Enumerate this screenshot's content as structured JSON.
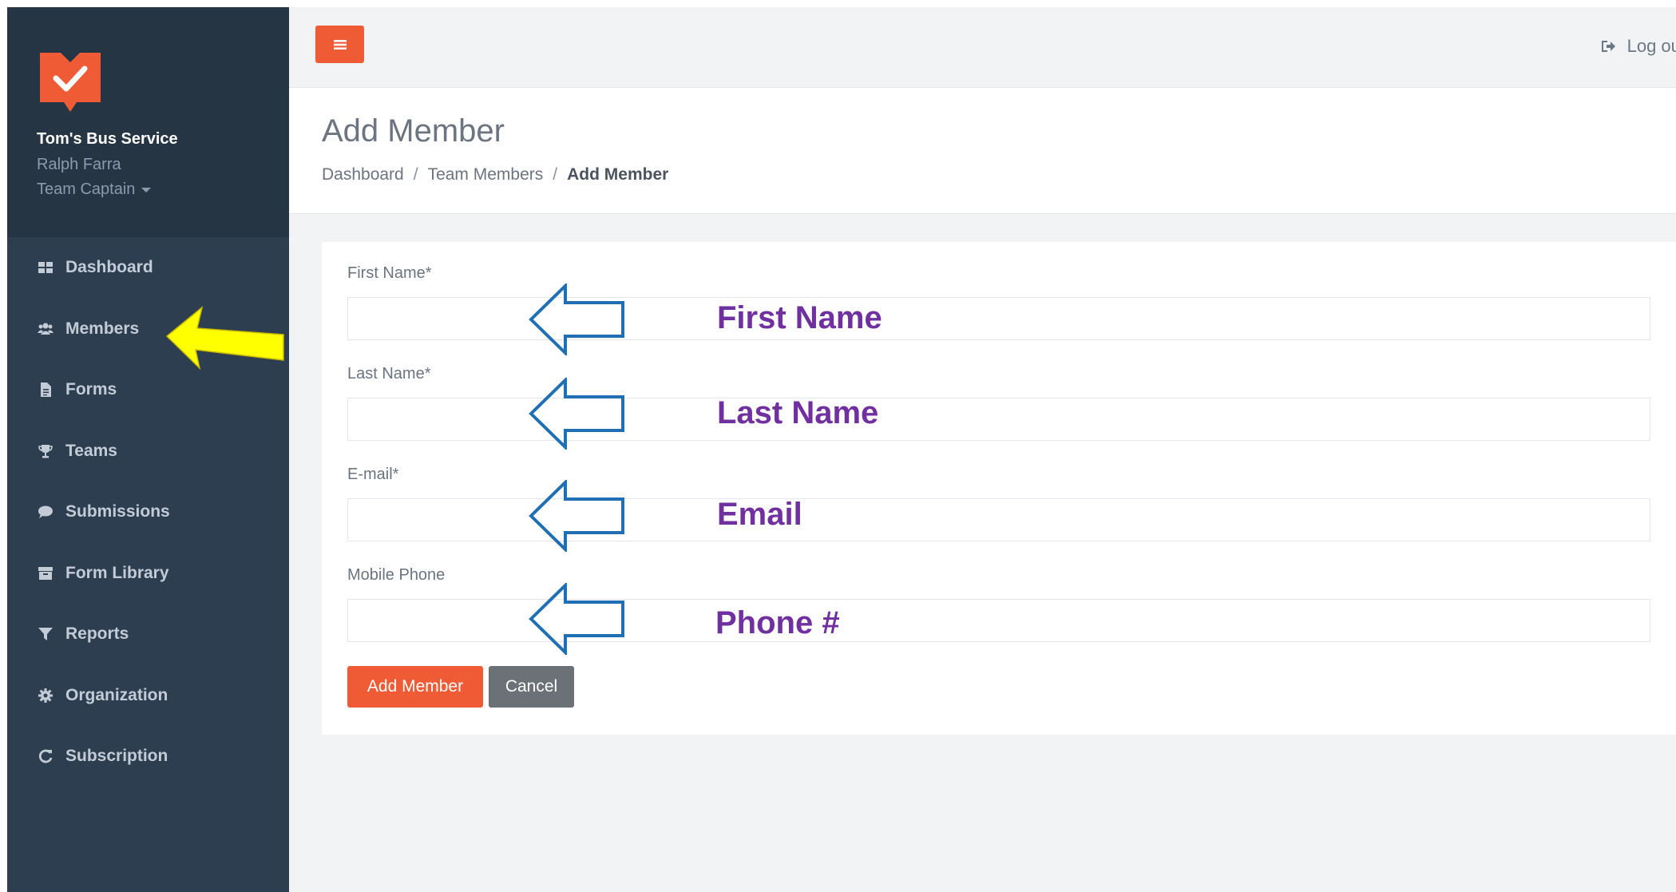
{
  "sidebar": {
    "org_name": "Tom's Bus Service",
    "user_name": "Ralph Farra",
    "user_role": "Team Captain",
    "items": [
      {
        "label": "Dashboard",
        "icon": "grid-icon"
      },
      {
        "label": "Members",
        "icon": "users-icon"
      },
      {
        "label": "Forms",
        "icon": "file-icon"
      },
      {
        "label": "Teams",
        "icon": "trophy-icon"
      },
      {
        "label": "Submissions",
        "icon": "comment-icon"
      },
      {
        "label": "Form Library",
        "icon": "archive-icon"
      },
      {
        "label": "Reports",
        "icon": "filter-icon"
      },
      {
        "label": "Organization",
        "icon": "gear-icon"
      },
      {
        "label": "Subscription",
        "icon": "refresh-icon"
      }
    ]
  },
  "topbar": {
    "logout_label": "Log out"
  },
  "header": {
    "title": "Add Member",
    "breadcrumb": [
      "Dashboard",
      "Team Members",
      "Add Member"
    ]
  },
  "form": {
    "fields": [
      {
        "label": "First Name*",
        "value": ""
      },
      {
        "label": "Last Name*",
        "value": ""
      },
      {
        "label": "E-mail*",
        "value": ""
      },
      {
        "label": "Mobile Phone",
        "value": ""
      }
    ],
    "submit_label": "Add Member",
    "cancel_label": "Cancel"
  },
  "annotations": [
    "First Name",
    "Last Name",
    "Email",
    "Phone #"
  ],
  "colors": {
    "accent": "#ef5b35",
    "sidebar": "#2d3e50",
    "annotation_text": "#7030a0",
    "annotation_arrow": "#1f6fb5",
    "highlight_arrow": "#ffff00"
  }
}
